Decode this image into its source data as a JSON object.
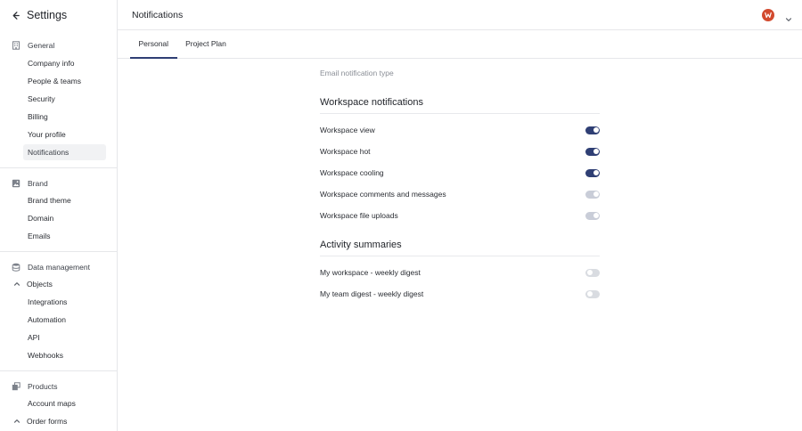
{
  "sidebar": {
    "title": "Settings",
    "general": {
      "label": "General",
      "items": [
        "Company info",
        "People & teams",
        "Security",
        "Billing",
        "Your profile",
        "Notifications"
      ],
      "active": "Notifications"
    },
    "brand": {
      "label": "Brand",
      "items": [
        "Brand theme",
        "Domain",
        "Emails"
      ]
    },
    "data_management": {
      "label": "Data management",
      "objects_label": "Objects",
      "items": [
        "Integrations",
        "Automation",
        "API",
        "Webhooks"
      ]
    },
    "products": {
      "label": "Products",
      "items": [
        "Account maps"
      ],
      "order_forms_label": "Order forms"
    }
  },
  "header": {
    "title": "Notifications",
    "avatar_icon": "brand-logo-icon"
  },
  "tabs": [
    {
      "label": "Personal",
      "active": true
    },
    {
      "label": "Project Plan",
      "active": false
    }
  ],
  "main": {
    "email_type_label": "Email notification type",
    "workspace": {
      "heading": "Workspace notifications",
      "rows": [
        {
          "label": "Workspace view",
          "state": "on"
        },
        {
          "label": "Workspace hot",
          "state": "on"
        },
        {
          "label": "Workspace cooling",
          "state": "on"
        },
        {
          "label": "Workspace comments and messages",
          "state": "dim"
        },
        {
          "label": "Workspace file uploads",
          "state": "dim"
        }
      ]
    },
    "activity": {
      "heading": "Activity summaries",
      "rows": [
        {
          "label": "My workspace - weekly digest",
          "state": "off"
        },
        {
          "label": "My team digest - weekly digest",
          "state": "off"
        }
      ]
    }
  },
  "colors": {
    "accent": "#2f3f74",
    "toggle_dim": "#c9cdd8",
    "toggle_off": "#d9dce1",
    "avatar": "#d24a2e"
  }
}
